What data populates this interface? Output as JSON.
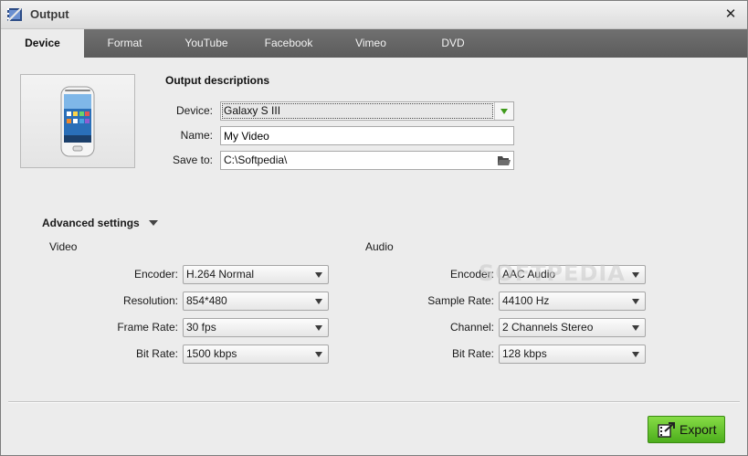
{
  "window": {
    "title": "Output",
    "close_glyph": "✕"
  },
  "tabs": [
    {
      "label": "Device",
      "active": true
    },
    {
      "label": "Format"
    },
    {
      "label": "YouTube"
    },
    {
      "label": "Facebook"
    },
    {
      "label": "Vimeo"
    },
    {
      "label": "DVD"
    }
  ],
  "output": {
    "section_title": "Output descriptions",
    "device_label": "Device:",
    "device_value": "Galaxy S III",
    "name_label": "Name:",
    "name_value": "My Video",
    "save_label": "Save to:",
    "save_value": "C:\\Softpedia\\"
  },
  "advanced": {
    "title": "Advanced settings",
    "video": {
      "title": "Video",
      "encoder_label": "Encoder:",
      "encoder_value": "H.264 Normal",
      "resolution_label": "Resolution:",
      "resolution_value": "854*480",
      "framerate_label": "Frame Rate:",
      "framerate_value": "30 fps",
      "bitrate_label": "Bit Rate:",
      "bitrate_value": "1500 kbps"
    },
    "audio": {
      "title": "Audio",
      "encoder_label": "Encoder:",
      "encoder_value": "AAC Audio",
      "samplerate_label": "Sample Rate:",
      "samplerate_value": "44100 Hz",
      "channel_label": "Channel:",
      "channel_value": "2 Channels Stereo",
      "bitrate_label": "Bit Rate:",
      "bitrate_value": "128 kbps"
    }
  },
  "watermark": "SOFTPEDIA",
  "export_label": "Export",
  "colors": {
    "tabbar": "#5e5e5e",
    "export_green": "#62c42a",
    "dropdown_green": "#3e9a1a"
  },
  "icons": [
    "app-film-icon",
    "close-icon",
    "phone-icon",
    "dropdown-arrow-icon",
    "folder-icon",
    "export-icon"
  ]
}
